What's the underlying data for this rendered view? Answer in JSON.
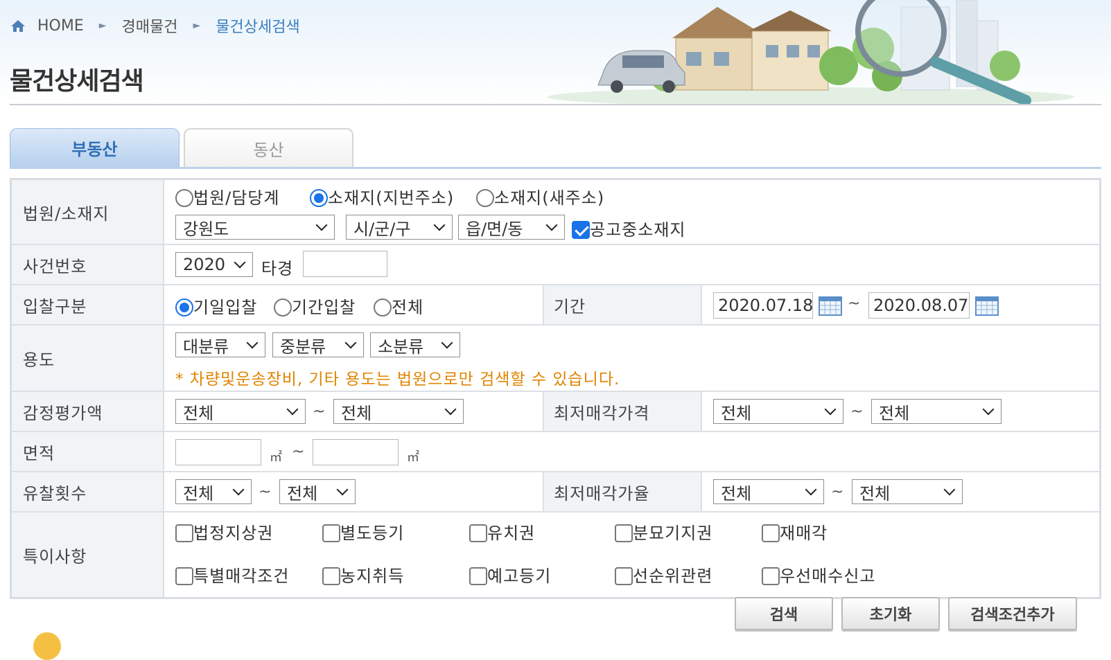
{
  "breadcrumb": {
    "home": "HOME",
    "level1": "경매물건",
    "current": "물건상세검색"
  },
  "page_title": "물건상세검색",
  "tabs": [
    {
      "label": "부동산",
      "active": true
    },
    {
      "label": "동산",
      "active": false
    }
  ],
  "form": {
    "court_location": {
      "label": "법원/소재지",
      "radio_court": "법원/담당계",
      "radio_lot_address": "소재지(지번주소)",
      "radio_new_address": "소재지(새주소)",
      "province": "강원도",
      "city": "시/군/구",
      "town": "읍/면/동",
      "announce_location": "공고중소재지"
    },
    "case_number": {
      "label": "사건번호",
      "year": "2020",
      "suffix": "타경",
      "number": ""
    },
    "bid_type": {
      "label": "입찰구분",
      "opt1": "기일입찰",
      "opt2": "기간입찰",
      "opt3": "전체",
      "period_label": "기간",
      "date_from": "2020.07.18",
      "date_to": "2020.08.07",
      "tilde": "~"
    },
    "usage": {
      "label": "용도",
      "major": "대분류",
      "middle": "중분류",
      "minor": "소분류",
      "note": "* 차량및운송장비, 기타 용도는 법원으로만 검색할 수 있습니다."
    },
    "appraisal": {
      "label": "감정평가액",
      "from": "전체",
      "to": "전체",
      "min_price_label": "최저매각가격",
      "min_from": "전체",
      "min_to": "전체"
    },
    "area": {
      "label": "면적",
      "from": "",
      "to": "",
      "unit": "㎡"
    },
    "failed_count": {
      "label": "유찰횟수",
      "from": "전체",
      "to": "전체",
      "min_rate_label": "최저매각가율",
      "rate_from": "전체",
      "rate_to": "전체"
    },
    "special": {
      "label": "특이사항",
      "items": [
        "법정지상권",
        "별도등기",
        "유치권",
        "분묘기지권",
        "재매각",
        "특별매각조건",
        "농지취득",
        "예고등기",
        "선순위관련",
        "우선매수신고"
      ]
    }
  },
  "buttons": {
    "search": "검색",
    "reset": "초기화",
    "add_condition": "검색조건추가"
  },
  "colors": {
    "accent": "#1a73e8",
    "tab_active_text": "#2f6fb8",
    "note": "#e08400"
  }
}
